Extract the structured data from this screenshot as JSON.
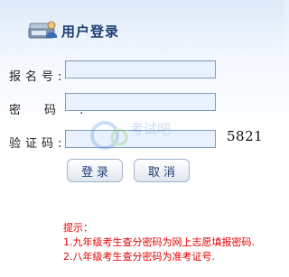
{
  "header": {
    "title": "用户登录",
    "icon": "computer-user-icon"
  },
  "form": {
    "exam_no_label": "报名号:",
    "password_label": "密码:",
    "captcha_label": "验证码:",
    "exam_no_value": "",
    "password_value": "",
    "captcha_value": "",
    "captcha_code": "5821"
  },
  "buttons": {
    "login": "登录",
    "cancel": "取消"
  },
  "tips": {
    "heading": "提示：",
    "line1": "1.九年级考生查分密码为网上志愿填报密码.",
    "line2": "2.八年级考生查分密码为准考证号."
  },
  "watermark": {
    "text": "考试吧"
  },
  "colors": {
    "title": "#1b3e70",
    "tips": "#e60000",
    "field_bg": "#e8f1fd",
    "field_border": "#7f9db9"
  }
}
